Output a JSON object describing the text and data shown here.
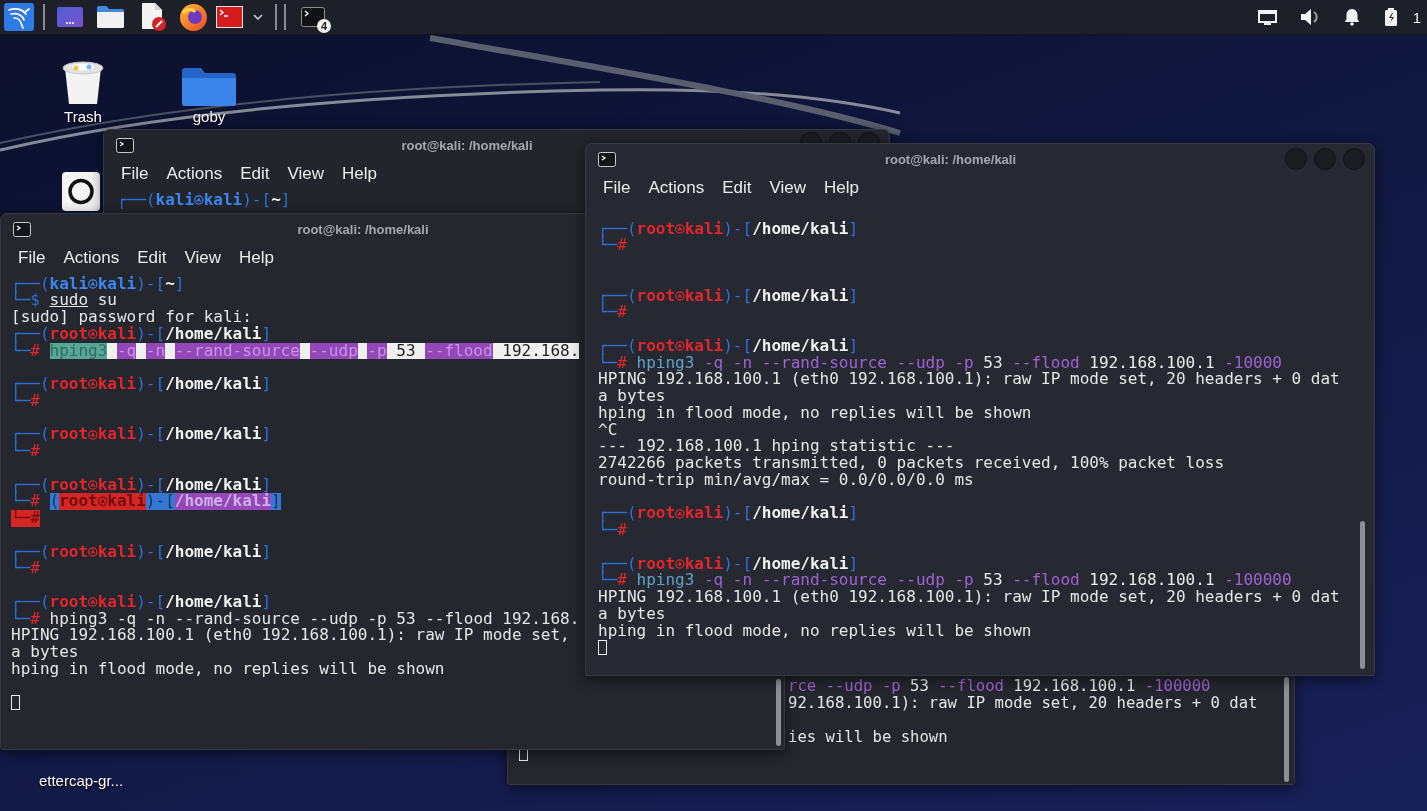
{
  "taskbar": {
    "task_badge": "4",
    "clock": "1"
  },
  "desktop_icons": [
    {
      "kind": "trash",
      "label": "Trash"
    },
    {
      "kind": "folder",
      "label": "goby"
    },
    {
      "kind": "disc"
    },
    {
      "kind": "covered",
      "label": "ettercap-gr..."
    }
  ],
  "windows": [
    {
      "title": "root@kali: /home/kali",
      "menu": [
        "File",
        "Actions",
        "Edit",
        "View",
        "Help"
      ],
      "lines": [
        {
          "kind": "prompt",
          "segments": [
            {
              "kind": "frame",
              "text": "┌──("
            },
            {
              "kind": "user",
              "user": "kali",
              "host": "kali"
            },
            {
              "kind": "frame",
              "text": ")-["
            },
            {
              "kind": "path",
              "text": "~"
            },
            {
              "kind": "frame",
              "text": "]"
            }
          ]
        }
      ]
    },
    {
      "lines": [
        {
          "kind": "input",
          "segments": [
            {
              "kind": "flag",
              "text": "rce --udp -p"
            },
            {
              "kind": "arg",
              "text": " 53"
            },
            {
              "kind": "flag",
              "text": " --flood"
            },
            {
              "kind": "arg",
              "text": " 192.168.100.1"
            },
            {
              "kind": "flag",
              "text": " -100000"
            }
          ]
        },
        {
          "kind": "output",
          "text": "92.168.100.1): raw IP mode set, 20 headers + 0 dat"
        },
        {
          "kind": "blank"
        },
        {
          "kind": "output",
          "text": "ies will be shown"
        },
        {
          "kind": "cursor"
        }
      ]
    },
    {
      "title": "root@kali: /home/kali",
      "menu": [
        "File",
        "Actions",
        "Edit",
        "View",
        "Help"
      ],
      "lines": [
        {
          "kind": "prompt",
          "segments": [
            {
              "kind": "frame",
              "text": "┌──("
            },
            {
              "kind": "user",
              "user": "kali",
              "host": "kali"
            },
            {
              "kind": "frame",
              "text": ")-["
            },
            {
              "kind": "path",
              "text": "~"
            },
            {
              "kind": "frame",
              "text": "]"
            }
          ]
        },
        {
          "kind": "input",
          "segments": [
            {
              "kind": "frame",
              "text": "└─$ "
            },
            {
              "kind": "precommand",
              "text": "sudo"
            },
            {
              "kind": "text",
              "text": " su"
            }
          ]
        },
        {
          "kind": "output",
          "text": "[sudo] password for kali:"
        },
        {
          "kind": "prompt",
          "segments": [
            {
              "kind": "frame",
              "text": "┌──("
            },
            {
              "kind": "root",
              "user": "root",
              "host": "kali"
            },
            {
              "kind": "frame",
              "text": ")-["
            },
            {
              "kind": "path",
              "text": "/home/kali"
            },
            {
              "kind": "frame",
              "text": "]"
            }
          ]
        },
        {
          "kind": "input",
          "segments": [
            {
              "kind": "frame",
              "text": "└─",
              "highlighted": false
            },
            {
              "kind": "hash",
              "text": "# ",
              "highlighted": false
            },
            {
              "kind": "command",
              "text": "hping3",
              "highlighted": true
            },
            {
              "kind": "gap",
              "highlighted": true
            },
            {
              "kind": "flag",
              "text": "-q",
              "highlighted": true
            },
            {
              "kind": "gap",
              "highlighted": true
            },
            {
              "kind": "flag",
              "text": "-n",
              "highlighted": true
            },
            {
              "kind": "gap",
              "highlighted": true
            },
            {
              "kind": "flag",
              "text": "--rand-source",
              "highlighted": true
            },
            {
              "kind": "gap",
              "highlighted": true
            },
            {
              "kind": "flag",
              "text": "--udp",
              "highlighted": true
            },
            {
              "kind": "gap",
              "highlighted": true
            },
            {
              "kind": "flag",
              "text": "-p",
              "highlighted": true
            },
            {
              "kind": "arg",
              "text": " 53 ",
              "highlighted": true
            },
            {
              "kind": "flag",
              "text": "--flood",
              "highlighted": true
            },
            {
              "kind": "arg",
              "text": " 192.168.",
              "highlighted": true
            }
          ]
        },
        {
          "kind": "blank"
        },
        {
          "kind": "prompt",
          "segments": [
            {
              "kind": "frame",
              "text": "┌──("
            },
            {
              "kind": "root",
              "user": "root",
              "host": "kali"
            },
            {
              "kind": "frame",
              "text": ")-["
            },
            {
              "kind": "path",
              "text": "/home/kali"
            },
            {
              "kind": "frame",
              "text": "]"
            }
          ]
        },
        {
          "kind": "input",
          "segments": [
            {
              "kind": "frame",
              "text": "└─"
            },
            {
              "kind": "hash",
              "text": "#"
            }
          ]
        },
        {
          "kind": "blank"
        },
        {
          "kind": "prompt",
          "segments": [
            {
              "kind": "frame",
              "text": "┌──("
            },
            {
              "kind": "root",
              "user": "root",
              "host": "kali"
            },
            {
              "kind": "frame",
              "text": ")-["
            },
            {
              "kind": "path",
              "text": "/home/kali"
            },
            {
              "kind": "frame",
              "text": "]"
            }
          ]
        },
        {
          "kind": "input",
          "segments": [
            {
              "kind": "frame",
              "text": "└─"
            },
            {
              "kind": "hash",
              "text": "#"
            }
          ]
        },
        {
          "kind": "blank"
        },
        {
          "kind": "prompt",
          "segments": [
            {
              "kind": "frame",
              "text": "┌──("
            },
            {
              "kind": "root",
              "user": "root",
              "host": "kali"
            },
            {
              "kind": "frame",
              "text": ")-["
            },
            {
              "kind": "path",
              "text": "/home/kali"
            },
            {
              "kind": "frame",
              "text": "]"
            }
          ]
        },
        {
          "kind": "input",
          "segments": [
            {
              "kind": "frame",
              "text": "└─",
              "highlighted": false
            },
            {
              "kind": "hash",
              "text": "# ",
              "highlighted": false
            },
            {
              "kind": "frame",
              "text": "(",
              "highlighted": true
            },
            {
              "kind": "root",
              "user": "root",
              "host": "kali",
              "highlighted": true
            },
            {
              "kind": "frame",
              "text": ")-[",
              "highlighted": true
            },
            {
              "kind": "path",
              "text": "/home/kali",
              "highlighted": true
            },
            {
              "kind": "frame",
              "text": "]",
              "highlighted": true
            }
          ]
        },
        {
          "kind": "input",
          "segments": [
            {
              "kind": "hash",
              "text": "└─#",
              "highlighted": true
            }
          ]
        },
        {
          "kind": "blank"
        },
        {
          "kind": "prompt",
          "segments": [
            {
              "kind": "frame",
              "text": "┌──("
            },
            {
              "kind": "root",
              "user": "root",
              "host": "kali"
            },
            {
              "kind": "frame",
              "text": ")-["
            },
            {
              "kind": "path",
              "text": "/home/kali"
            },
            {
              "kind": "frame",
              "text": "]"
            }
          ]
        },
        {
          "kind": "input",
          "segments": [
            {
              "kind": "frame",
              "text": "└─"
            },
            {
              "kind": "hash",
              "text": "#"
            }
          ]
        },
        {
          "kind": "blank"
        },
        {
          "kind": "prompt",
          "segments": [
            {
              "kind": "frame",
              "text": "┌──("
            },
            {
              "kind": "root",
              "user": "root",
              "host": "kali"
            },
            {
              "kind": "frame",
              "text": ")-["
            },
            {
              "kind": "path",
              "text": "/home/kali"
            },
            {
              "kind": "frame",
              "text": "]"
            }
          ]
        },
        {
          "kind": "input",
          "segments": [
            {
              "kind": "frame",
              "text": "└─"
            },
            {
              "kind": "hash",
              "text": "# "
            },
            {
              "kind": "text",
              "text": "hping3 -q -n --rand-source --udp -p 53 --flood 192.168."
            }
          ]
        },
        {
          "kind": "output",
          "text": "HPING 192.168.100.1 (eth0 192.168.100.1): raw IP mode set,"
        },
        {
          "kind": "output",
          "text": "a bytes"
        },
        {
          "kind": "output",
          "text": "hping in flood mode, no replies will be shown"
        },
        {
          "kind": "blank"
        },
        {
          "kind": "cursor"
        }
      ]
    },
    {
      "title": "root@kali: /home/kali",
      "menu": [
        "File",
        "Actions",
        "Edit",
        "View",
        "Help"
      ],
      "lines": [
        {
          "kind": "prompt",
          "segments": [
            {
              "kind": "frame",
              "text": "┌──("
            },
            {
              "kind": "root",
              "user": "root",
              "host": "kali"
            },
            {
              "kind": "frame",
              "text": ")-["
            },
            {
              "kind": "path",
              "text": "/home/kali"
            },
            {
              "kind": "frame",
              "text": "]"
            }
          ]
        },
        {
          "kind": "input",
          "segments": [
            {
              "kind": "frame",
              "text": "└─"
            },
            {
              "kind": "hash",
              "text": "#"
            }
          ]
        },
        {
          "kind": "blank"
        },
        {
          "kind": "blank"
        },
        {
          "kind": "prompt",
          "segments": [
            {
              "kind": "frame",
              "text": "┌──("
            },
            {
              "kind": "root",
              "user": "root",
              "host": "kali"
            },
            {
              "kind": "frame",
              "text": ")-["
            },
            {
              "kind": "path",
              "text": "/home/kali"
            },
            {
              "kind": "frame",
              "text": "]"
            }
          ]
        },
        {
          "kind": "input",
          "segments": [
            {
              "kind": "frame",
              "text": "└─"
            },
            {
              "kind": "hash",
              "text": "#"
            }
          ]
        },
        {
          "kind": "blank"
        },
        {
          "kind": "prompt",
          "segments": [
            {
              "kind": "frame",
              "text": "┌──("
            },
            {
              "kind": "root",
              "user": "root",
              "host": "kali"
            },
            {
              "kind": "frame",
              "text": ")-["
            },
            {
              "kind": "path",
              "text": "/home/kali"
            },
            {
              "kind": "frame",
              "text": "]"
            }
          ]
        },
        {
          "kind": "input",
          "segments": [
            {
              "kind": "frame",
              "text": "└─"
            },
            {
              "kind": "hash",
              "text": "# "
            },
            {
              "kind": "command",
              "text": "hping3"
            },
            {
              "kind": "flag",
              "text": " -q -n --rand-source --udp -p"
            },
            {
              "kind": "arg",
              "text": " 53"
            },
            {
              "kind": "flag",
              "text": " --flood"
            },
            {
              "kind": "arg",
              "text": " 192.168.100.1"
            },
            {
              "kind": "flag",
              "text": " -10000"
            }
          ]
        },
        {
          "kind": "output",
          "text": "HPING 192.168.100.1 (eth0 192.168.100.1): raw IP mode set, 20 headers + 0 dat"
        },
        {
          "kind": "output",
          "text": "a bytes"
        },
        {
          "kind": "output",
          "text": "hping in flood mode, no replies will be shown"
        },
        {
          "kind": "output",
          "text": "^C"
        },
        {
          "kind": "output",
          "text": "--- 192.168.100.1 hping statistic ---"
        },
        {
          "kind": "output",
          "text": "2742266 packets transmitted, 0 packets received, 100% packet loss"
        },
        {
          "kind": "output",
          "text": "round-trip min/avg/max = 0.0/0.0/0.0 ms"
        },
        {
          "kind": "blank"
        },
        {
          "kind": "prompt",
          "segments": [
            {
              "kind": "frame",
              "text": "┌──("
            },
            {
              "kind": "root",
              "user": "root",
              "host": "kali"
            },
            {
              "kind": "frame",
              "text": ")-["
            },
            {
              "kind": "path",
              "text": "/home/kali"
            },
            {
              "kind": "frame",
              "text": "]"
            }
          ]
        },
        {
          "kind": "input",
          "segments": [
            {
              "kind": "frame",
              "text": "└─"
            },
            {
              "kind": "hash",
              "text": "#"
            }
          ]
        },
        {
          "kind": "blank"
        },
        {
          "kind": "prompt",
          "segments": [
            {
              "kind": "frame",
              "text": "┌──("
            },
            {
              "kind": "root",
              "user": "root",
              "host": "kali"
            },
            {
              "kind": "frame",
              "text": ")-["
            },
            {
              "kind": "path",
              "text": "/home/kali"
            },
            {
              "kind": "frame",
              "text": "]"
            }
          ]
        },
        {
          "kind": "input",
          "segments": [
            {
              "kind": "frame",
              "text": "└─"
            },
            {
              "kind": "hash",
              "text": "# "
            },
            {
              "kind": "command",
              "text": "hping3"
            },
            {
              "kind": "flag",
              "text": " -q -n --rand-source --udp -p"
            },
            {
              "kind": "arg",
              "text": " 53"
            },
            {
              "kind": "flag",
              "text": " --flood"
            },
            {
              "kind": "arg",
              "text": " 192.168.100.1"
            },
            {
              "kind": "flag",
              "text": " -100000"
            }
          ]
        },
        {
          "kind": "output",
          "text": "HPING 192.168.100.1 (eth0 192.168.100.1): raw IP mode set, 20 headers + 0 dat"
        },
        {
          "kind": "output",
          "text": "a bytes"
        },
        {
          "kind": "output",
          "text": "hping in flood mode, no replies will be shown"
        },
        {
          "kind": "cursor"
        }
      ]
    }
  ]
}
